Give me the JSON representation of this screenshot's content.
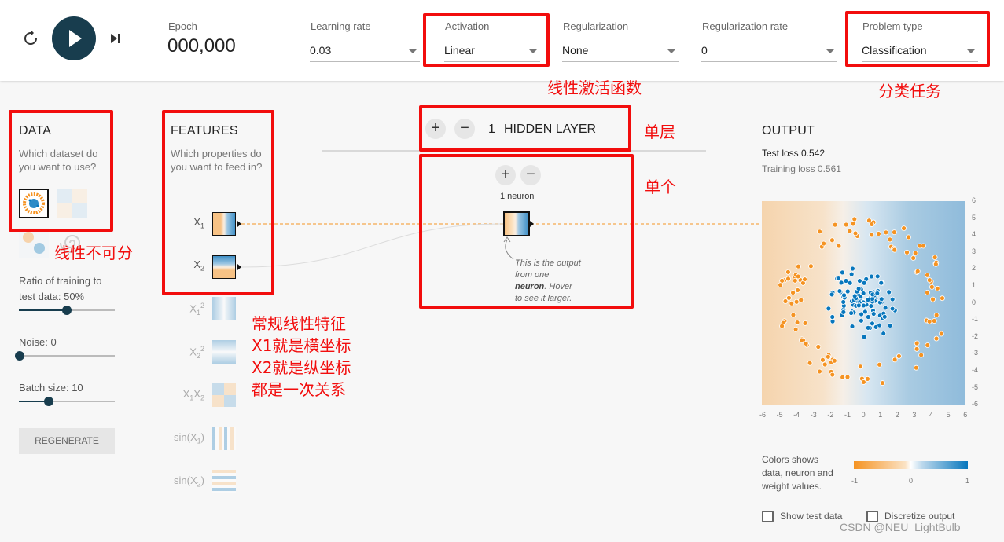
{
  "header": {
    "epoch_label": "Epoch",
    "epoch_value": "000,000",
    "learning_rate": {
      "label": "Learning rate",
      "value": "0.03"
    },
    "activation": {
      "label": "Activation",
      "value": "Linear"
    },
    "regularization": {
      "label": "Regularization",
      "value": "None"
    },
    "regularization_rate": {
      "label": "Regularization rate",
      "value": "0"
    },
    "problem_type": {
      "label": "Problem type",
      "value": "Classification"
    }
  },
  "data_panel": {
    "title": "DATA",
    "subtitle_1": "Which dataset do",
    "subtitle_2": "you want to use?",
    "ratio_label": "Ratio of training to",
    "ratio_label_2": "test data:  50%",
    "ratio_value": 50,
    "noise_label": "Noise:  0",
    "noise_value": 0,
    "batch_label": "Batch size:  10",
    "batch_value": 10,
    "regenerate_label": "REGENERATE"
  },
  "features_panel": {
    "title": "FEATURES",
    "subtitle_1": "Which properties do",
    "subtitle_2": "you want to feed in?",
    "features": [
      {
        "base": "X",
        "sub": "1",
        "sup": "",
        "active": true
      },
      {
        "base": "X",
        "sub": "2",
        "sup": "",
        "active": true
      },
      {
        "base": "X",
        "sub": "1",
        "sup": "2",
        "active": false
      },
      {
        "base": "X",
        "sub": "2",
        "sup": "2",
        "active": false
      },
      {
        "base": "X",
        "sub": "1",
        "base2": "X",
        "sub2": "2",
        "active": false
      },
      {
        "base": "sin(X",
        "sub": "1",
        "tail": ")",
        "active": false
      },
      {
        "base": "sin(X",
        "sub": "2",
        "tail": ")",
        "active": false
      }
    ]
  },
  "network": {
    "layer_count": "1",
    "layer_label": "HIDDEN LAYER",
    "neuron_label": "1 neuron",
    "note_1": "This is the output",
    "note_2": "from one",
    "note_3_bold": "neuron",
    "note_3_rest": ". Hover",
    "note_4": "to see it larger."
  },
  "output_panel": {
    "title": "OUTPUT",
    "test_loss": "Test loss 0.542",
    "training_loss": "Training loss 0.561",
    "legend_1": "Colors shows",
    "legend_2": "data, neuron and",
    "legend_3": "weight values.",
    "legend_min": "-1",
    "legend_mid": "0",
    "legend_max": "1",
    "show_test_label": "Show test data",
    "discretize_label": "Discretize output",
    "x_ticks": [
      "-6",
      "-5",
      "-4",
      "-3",
      "-2",
      "-1",
      "0",
      "1",
      "2",
      "3",
      "4",
      "5",
      "6"
    ],
    "y_ticks": [
      "6",
      "5",
      "4",
      "3",
      "2",
      "1",
      "0",
      "-1",
      "-2",
      "-3",
      "-4",
      "-5",
      "-6"
    ]
  },
  "annotations": {
    "activation_note": "线性激活函数",
    "problem_note": "分类任务",
    "layer_note": "单层",
    "neuron_note": "单个",
    "data_note": "线性不可分",
    "feature_note_1": "常规线性特征",
    "feature_note_2": "X1就是横坐标",
    "feature_note_3": "X2就是纵坐标",
    "feature_note_4": "都是一次关系"
  },
  "watermark": "CSDN @NEU_LightBulb",
  "colors": {
    "orange": "#f59322",
    "blue": "#0877bd",
    "dark": "#183d4e",
    "annotation_red": "#f20d0d"
  }
}
